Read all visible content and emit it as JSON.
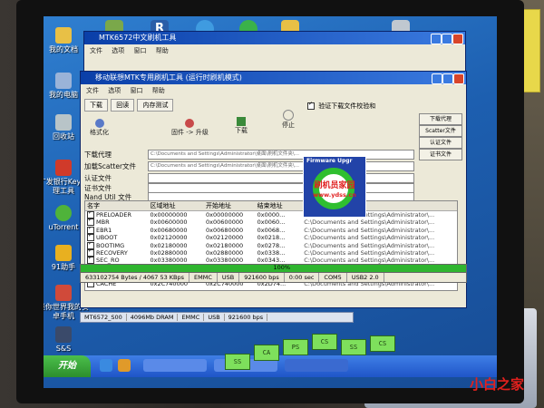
{
  "desktop": {
    "icons": [
      "我的文档",
      "我的电脑",
      "回收站",
      "广发银行Key管理工具",
      "uTorrent",
      "91助手",
      "迷你世界我的安卓手机",
      "S&S"
    ]
  },
  "window_back": {
    "title": "MTK6572中文刷机工具",
    "menu": [
      "文件",
      "选项",
      "窗口",
      "帮助"
    ]
  },
  "window_main": {
    "title": "移动联想MTK专用刷机工具 (运行时刷机模式)",
    "menu": [
      "文件",
      "选项",
      "窗口",
      "帮助"
    ],
    "tabs": [
      "下载",
      "回读",
      "内存测试"
    ],
    "tools": [
      "格式化",
      "固件 -> 升级",
      "下载",
      "停止"
    ],
    "checkbox_label": "验证下载文件校验和",
    "right_buttons": [
      "下载代理",
      "Scatter文件",
      "认证文件",
      "证书文件"
    ],
    "paths": [
      {
        "label": "下载代理",
        "value": "C:\\Documents and Settings\\Administrator\\桌面\\刷机文件夹\\..."
      },
      {
        "label": "加载Scatter文件",
        "value": "C:\\Documents and Settings\\Administrator\\桌面\\刷机文件夹\\..."
      },
      {
        "label": "认证文件",
        "value": ""
      },
      {
        "label": "证书文件",
        "value": ""
      },
      {
        "label": "Nand Util 文件",
        "value": ""
      }
    ],
    "table": {
      "columns": [
        "名字",
        "区域地址",
        "开始地址",
        "结束地址",
        "位置"
      ],
      "rows": [
        [
          "PRELOADER",
          "0x00000000",
          "0x00000000",
          "0x0000...",
          "C:\\Documents and Settings\\Administrator\\..."
        ],
        [
          "MBR",
          "0x00600000",
          "0x00600000",
          "0x0060...",
          "C:\\Documents and Settings\\Administrator\\..."
        ],
        [
          "EBR1",
          "0x00680000",
          "0x00680000",
          "0x0068...",
          "C:\\Documents and Settings\\Administrator\\..."
        ],
        [
          "UBOOT",
          "0x02120000",
          "0x02120000",
          "0x0218...",
          "C:\\Documents and Settings\\Administrator\\..."
        ],
        [
          "BOOTIMG",
          "0x02180000",
          "0x02180000",
          "0x0278...",
          "C:\\Documents and Settings\\Administrator\\..."
        ],
        [
          "RECOVERY",
          "0x02880000",
          "0x02880000",
          "0x0338...",
          "C:\\Documents and Settings\\Administrator\\..."
        ],
        [
          "SEC_RO",
          "0x03380000",
          "0x03380000",
          "0x0343...",
          "C:\\Documents and Settings\\Administrator\\..."
        ],
        [
          "LOGO",
          "0x03840000",
          "0x03840000",
          "0x03E4...",
          "C:\\Documents and Settings\\Administrator\\..."
        ],
        [
          "ANDROID",
          "0x04340000",
          "0x04340000",
          "0x2D34...",
          "C:\\Documents and Settings\\Administrator\\..."
        ],
        [
          "CACHE",
          "0x2C740000",
          "0x2C740000",
          "0x2D74...",
          "C:\\Documents and Settings\\Administrator\\..."
        ]
      ]
    },
    "progress": {
      "label": "100%",
      "value": 1.0
    },
    "status": [
      "633102754 Bytes / 4067 53 KBps",
      "EMMC",
      "USB",
      "921600 bps",
      "0:00 sec",
      "COM5",
      "USB2 2.0"
    ]
  },
  "popup": {
    "title": "Firmware Upgr",
    "brand": "刷机员家园",
    "url": "www.ydss.cn"
  },
  "infobar": [
    "MT6572_S00",
    "4096Mb DRAM",
    "EMMC",
    "USB",
    "921600 bps"
  ],
  "taskbar": {
    "start": "开始",
    "leds": [
      "SS",
      "CA",
      "PS",
      "CS",
      "SS",
      "CS"
    ]
  },
  "watermark": "小白之家",
  "colors": {
    "title_blue": "#0a3fa8",
    "progress_green": "#2fb52f",
    "brand_red": "#e02020"
  }
}
